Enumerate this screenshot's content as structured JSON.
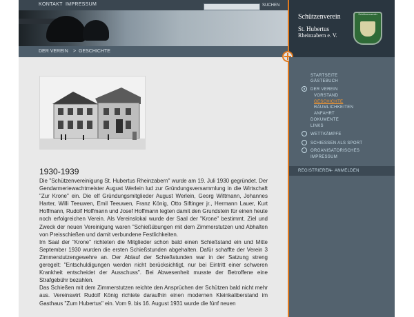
{
  "header": {
    "nav": [
      "KONTAKT",
      "IMPRESSUM"
    ],
    "search_button": "SUCHEN",
    "breadcrumb": [
      "DER VEREIN",
      "GESCHICHTE"
    ],
    "breadcrumb_separator": ">",
    "club_name_1": "Schützenverein",
    "club_name_2": "St. Hubertus",
    "club_name_3": "Rheinzabern e. V.",
    "crest_text": "Schützenverein"
  },
  "sidebar": {
    "items": [
      {
        "label": "STARTSEITE"
      },
      {
        "label": "GÄSTEBUCH"
      },
      {
        "label": "DER VEREIN"
      },
      {
        "label": "VORSTAND"
      },
      {
        "label": "GESCHICHTE"
      },
      {
        "label": "RÄUMLICHKEITEN"
      },
      {
        "label": "ANFAHRT"
      },
      {
        "label": "DOKUMENTE"
      },
      {
        "label": "LINKS"
      },
      {
        "label": "WETTKÄMPFE"
      },
      {
        "label": "SCHIESSEN ALS SPORT"
      },
      {
        "label": "ORGANISATORISCHES"
      },
      {
        "label": "IMPRESSUM"
      }
    ],
    "register": "REGISTRIEREN",
    "login": "ANMELDEN",
    "separator": "—"
  },
  "content": {
    "title": "1930-1939",
    "paragraphs": [
      "Die \"Schützenvereinigung St. Hubertus Rheinzabern\" wurde am 19. Juli 1930 gegründet. Der Gendarmeriewachtmeister August Werlein lud zur Gründungsversammlung in die Wirtschaft \"Zur Krone\" ein. Die elf Gründungsmitglieder August Werlein, Georg Wittmann, Johannes Harter, Willi Teeuwen, Emil Teeuwen, Franz König, Otto Siftinger jr., Hermann Lauer, Kurt Hoffmann, Rudolf Hoffmann und Josef Hoffmann legten damit den Grundstein für einen heute noch erfolgreichen Verein. Als Vereinslokal wurde der Saal der \"Krone\" bestimmt. Ziel und Zweck der neuen Vereinigung waren \"Schießübungen mit dem Zimmerstutzen und Abhalten von Preisschießen und damit verbundene Festlichkeiten.",
      "Im Saal der \"Krone\" richteten die Mitglieder schon bald einen Schießstand ein und Mitte September 1930 wurden die ersten Schießstunden abgehalten. Dafür schaffte der Verein 3 Zimmerstutzengewehre an. Der Ablauf der Schießstunden war in der Satzung streng geregelt: \"Entschuldigungen werden nicht berücksichtigt, nur bei Eintritt einer schweren Krankheit entscheidet der Ausschuss\". Bei Abwesenheit musste der Betroffene eine Strafgebühr bezahlen.",
      "Das Schießen mit dem Zimmerstutzen reichte den Ansprüchen der Schützen bald nicht mehr aus. Vereinswirt Rudolf König richtete daraufhin einen modernen Kleinkaliberstand im Gasthaus \"Zum Hubertus\" ein.    Vom 9. bis 16. August 1931 wurde die fünf neuen"
    ]
  }
}
